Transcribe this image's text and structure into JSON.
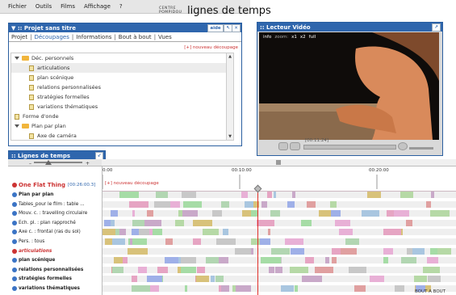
{
  "menu": [
    "Fichier",
    "Outils",
    "Films",
    "Affichage",
    "?"
  ],
  "logo": {
    "line1": "CENTRE",
    "line2": "POMPIDOU"
  },
  "app_title": "lignes de temps",
  "project": {
    "title": "▼ :: Projet sans titre",
    "aide": "aide",
    "tabs": [
      "Projet",
      "Découpages",
      "Informations",
      "Bout à bout",
      "Vues"
    ],
    "new_cut": "[+] nouveau découpage",
    "tree": [
      {
        "label": "Déc. personnels",
        "kind": "folder",
        "indent": 0
      },
      {
        "label": "articulations",
        "kind": "doc",
        "indent": 1,
        "selected": true
      },
      {
        "label": "plan scénique",
        "kind": "doc",
        "indent": 1
      },
      {
        "label": "relations personnalisées",
        "kind": "doc",
        "indent": 1
      },
      {
        "label": "stratégies formelles",
        "kind": "doc",
        "indent": 1
      },
      {
        "label": "variations thématiques",
        "kind": "doc",
        "indent": 1
      },
      {
        "label": "Forme d'onde",
        "kind": "doc",
        "indent": 0
      },
      {
        "label": "Plan par plan",
        "kind": "folder",
        "indent": 0
      },
      {
        "label": "Axe de caméra",
        "kind": "doc",
        "indent": 1
      }
    ]
  },
  "video": {
    "title": ":: Lecteur Vidéo",
    "info": "info",
    "zoom_label": "zoom:",
    "zoom_options": [
      "x1",
      "x2",
      "full"
    ],
    "time": "[00:11:24]"
  },
  "timeline": {
    "title": ":: Lignes de temps",
    "ticks": [
      "0:00",
      "00:10:00",
      "00:20:00"
    ],
    "main_track": {
      "name": "One Flat Thing",
      "duration": "[00:26:00.3]",
      "new_cut": "[+] nouveau découpage"
    },
    "bout_a_bout": "BOUT A BOUT",
    "tracks": [
      {
        "label": "Plan par plan",
        "bold": true,
        "red": false
      },
      {
        "label": "Tables_pour le film : table ...",
        "bold": false,
        "red": false
      },
      {
        "label": "Mouv. c. : travelling circulaire",
        "bold": false,
        "red": false
      },
      {
        "label": "Ech. pl. : plan rapproché",
        "bold": false,
        "red": false
      },
      {
        "label": "Axe c. : frontal (ras du sol)",
        "bold": false,
        "red": false
      },
      {
        "label": "Pers. : tous",
        "bold": false,
        "red": false
      },
      {
        "label": "articulations",
        "bold": true,
        "red": true
      },
      {
        "label": "plan scénique",
        "bold": true,
        "red": false
      },
      {
        "label": "relations personnalisées",
        "bold": true,
        "red": false
      },
      {
        "label": "stratégies formelles",
        "bold": true,
        "red": false
      },
      {
        "label": "variations thématiques",
        "bold": true,
        "red": false
      }
    ]
  },
  "colors": {
    "accent": "#2f66ad",
    "playhead": "#e0302a",
    "link": "#cc3333"
  }
}
